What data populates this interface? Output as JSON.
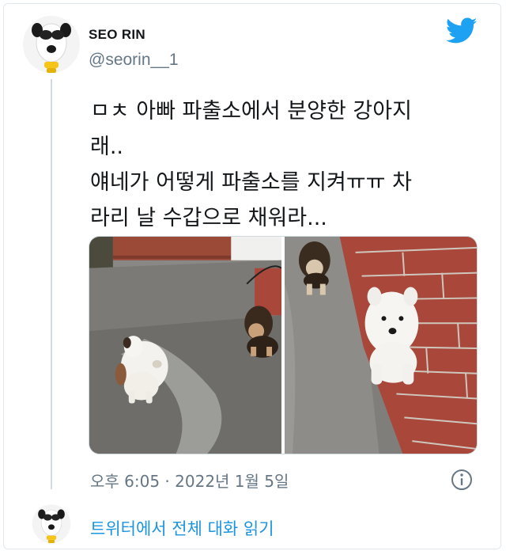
{
  "tweet": {
    "display_name": "SEO RIN",
    "handle": "@seorin__1",
    "text_lines": [
      "ㅁㅊ 아빠 파출소에서 분양한 강아지",
      "래..",
      "얘네가 어떻게 파출소를 지켜ㅠㅠ 차",
      "라리 날 수갑으로 채워라..."
    ],
    "timestamp": "오후 6:05 · 2022년 1월 5일",
    "read_more_link": "트위터에서 전체 대화 읽기"
  },
  "icons": {
    "brand": "twitter-bird-icon",
    "info": "info-icon"
  },
  "colors": {
    "twitter_blue": "#1da1f2",
    "link_blue": "#1b95e0",
    "secondary_text": "#657786",
    "thread_line": "#d3dbe1"
  }
}
